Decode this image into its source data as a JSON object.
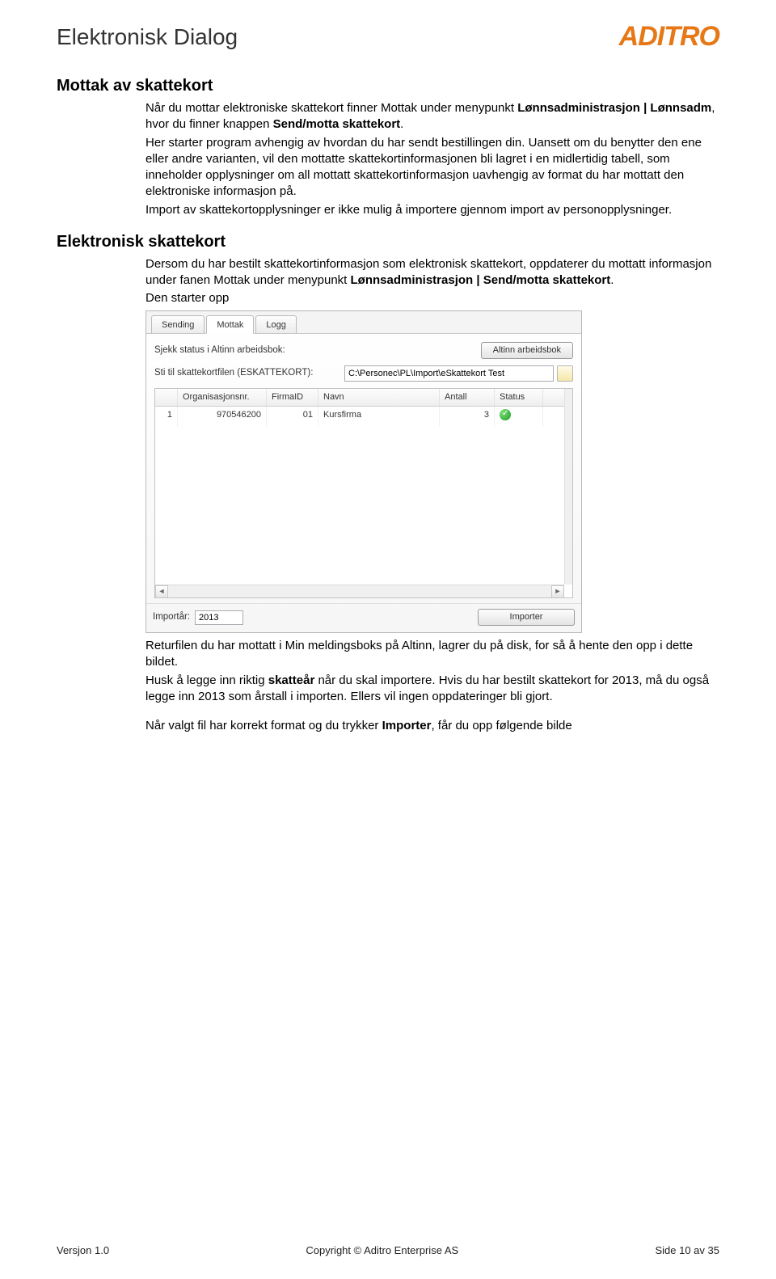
{
  "header": {
    "doc_title": "Elektronisk Dialog",
    "logo_text": "ADITRO"
  },
  "section1": {
    "heading": "Mottak av skattekort",
    "p1_a": "Når du mottar elektroniske skattekort finner Mottak under menypunkt ",
    "p1_b": "Lønnsadministrasjon | Lønnsadm",
    "p1_c": ", hvor du finner knappen ",
    "p1_d": "Send/motta skattekort",
    "p1_e": ".",
    "p2": "Her starter program avhengig av hvordan du har sendt bestillingen din. Uansett om du benytter den ene eller andre varianten, vil den mottatte skattekortinformasjonen bli lagret i en midlertidig tabell, som inneholder opplysninger om all mottatt skattekortinformasjon uavhengig av format du har mottatt den elektroniske informasjon på.",
    "p3": "Import av skattekortopplysninger er ikke mulig å importere gjennom import av personopplysninger."
  },
  "section2": {
    "heading": "Elektronisk skattekort",
    "p1_a": "Dersom du har bestilt skattekortinformasjon som elektronisk skattekort, oppdaterer du mottatt informasjon under fanen Mottak under menypunkt ",
    "p1_b": "Lønnsadministrasjon | Send/motta skattekort",
    "p1_c": ".",
    "p2": "Den starter opp",
    "p3": "Returfilen du har mottatt i Min meldingsboks på Altinn, lagrer du på disk, for så å hente den opp i dette bildet.",
    "p4_a": "Husk å legge inn riktig ",
    "p4_b": "skatteår",
    "p4_c": " når du skal importere. Hvis du har bestilt skattekort for 2013, må du også legge inn 2013 som årstall i importen. Ellers vil ingen oppdateringer bli gjort.",
    "p5_a": "Når valgt fil har korrekt format og du trykker ",
    "p5_b": "Importer",
    "p5_c": ", får du opp følgende bilde"
  },
  "app": {
    "tabs": {
      "sending": "Sending",
      "mottak": "Mottak",
      "logg": "Logg"
    },
    "row1_label": "Sjekk status i Altinn arbeidsbok:",
    "row1_button": "Altinn arbeidsbok",
    "row2_label": "Sti til skattekortfilen (ESKATTEKORT):",
    "row2_value": "C:\\Personec\\PL\\Import\\eSkattekort Test",
    "grid": {
      "headers": {
        "idx": "",
        "org": "Organisasjonsnr.",
        "firma": "FirmaID",
        "navn": "Navn",
        "antall": "Antall",
        "status": "Status"
      },
      "row": {
        "idx": "1",
        "org": "970546200",
        "firma": "01",
        "navn": "Kursfirma",
        "antall": "3"
      }
    },
    "importar_label": "Importår:",
    "importar_value": "2013",
    "import_button": "Importer"
  },
  "footer": {
    "left": "Versjon 1.0",
    "center": "Copyright © Aditro Enterprise AS",
    "right": "Side 10 av 35"
  }
}
